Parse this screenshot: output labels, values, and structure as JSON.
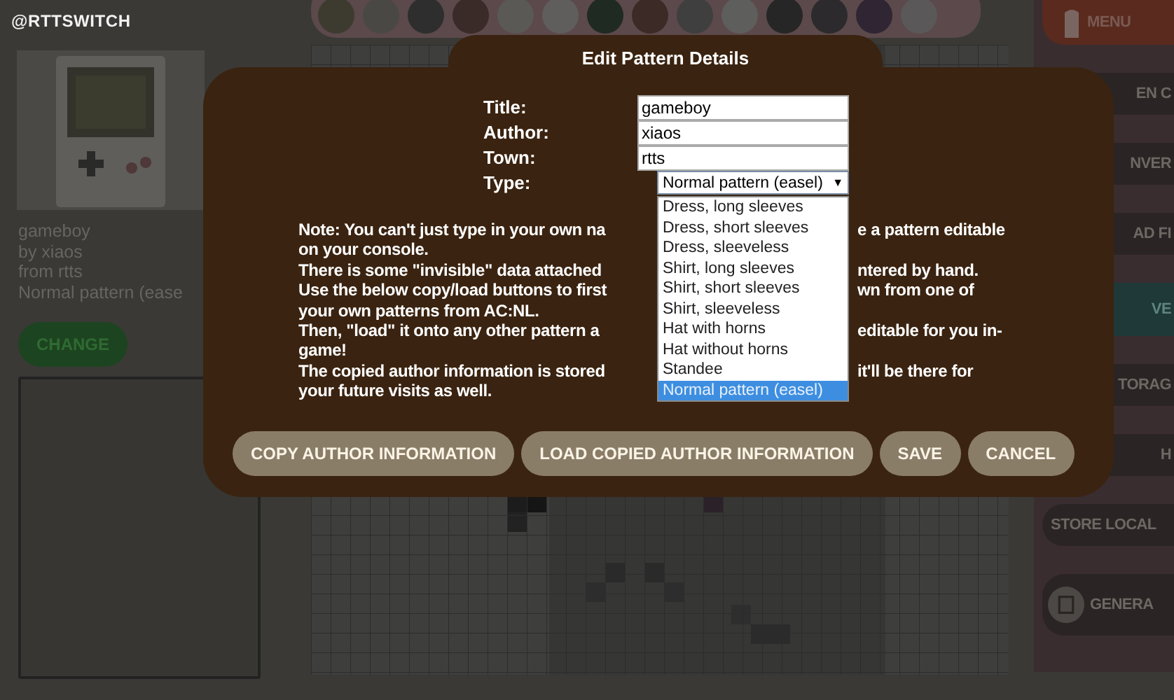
{
  "logo": "@RTTSWITCH",
  "preview": {
    "lines": [
      "gameboy",
      "by xiaos",
      "from rtts",
      "Normal pattern (ease"
    ],
    "button": "CHANGE"
  },
  "side_menu": [
    {
      "label": "MENU",
      "kind": "menu"
    },
    {
      "label": "EN C",
      "kind": "dark"
    },
    {
      "label": "NVER",
      "kind": "dark"
    },
    {
      "label": "AD FI",
      "kind": "dark"
    },
    {
      "label": "VE",
      "kind": "teal"
    },
    {
      "label": "TORAG",
      "kind": "dark"
    },
    {
      "label": "H",
      "kind": "dark"
    },
    {
      "label": "STORE LOCAL",
      "kind": "plain"
    },
    {
      "label": "GENERA",
      "kind": "icon"
    }
  ],
  "dialog": {
    "title": "Edit Pattern Details",
    "fields": [
      {
        "label": "Title:",
        "value": "gameboy"
      },
      {
        "label": "Author:",
        "value": "xiaos"
      },
      {
        "label": "Town:",
        "value": "rtts"
      }
    ],
    "type_field": {
      "label": "Type:",
      "value": "Normal pattern (easel)",
      "caret": "▼",
      "options": [
        {
          "label": "Dress, long sleeves",
          "selected": false
        },
        {
          "label": "Dress, short sleeves",
          "selected": false
        },
        {
          "label": "Dress, sleeveless",
          "selected": false
        },
        {
          "label": "Shirt, long sleeves",
          "selected": false
        },
        {
          "label": "Shirt, short sleeves",
          "selected": false
        },
        {
          "label": "Shirt, sleeveless",
          "selected": false
        },
        {
          "label": "Hat with horns",
          "selected": false
        },
        {
          "label": "Hat without horns",
          "selected": false
        },
        {
          "label": "Standee",
          "selected": false
        },
        {
          "label": "Normal pattern (easel)",
          "selected": true
        }
      ]
    },
    "note_lines": [
      [
        "Note: You can't just type in your own na",
        "e a pattern editable"
      ],
      [
        "on your console."
      ],
      [
        "There is some \"invisible\" data attached",
        "ntered by hand."
      ],
      [
        "Use the below copy/load buttons to first",
        "wn from one of"
      ],
      [
        "your own patterns from AC:NL."
      ],
      [
        "Then, \"load\" it onto any other pattern a",
        "editable for you in-"
      ],
      [
        "game!"
      ],
      [
        "The copied author information is stored",
        "it'll be there for"
      ],
      [
        "your future visits as well."
      ]
    ],
    "buttons": [
      "COPY AUTHOR INFORMATION",
      "LOAD COPIED AUTHOR INFORMATION",
      "SAVE",
      "CANCEL"
    ]
  }
}
